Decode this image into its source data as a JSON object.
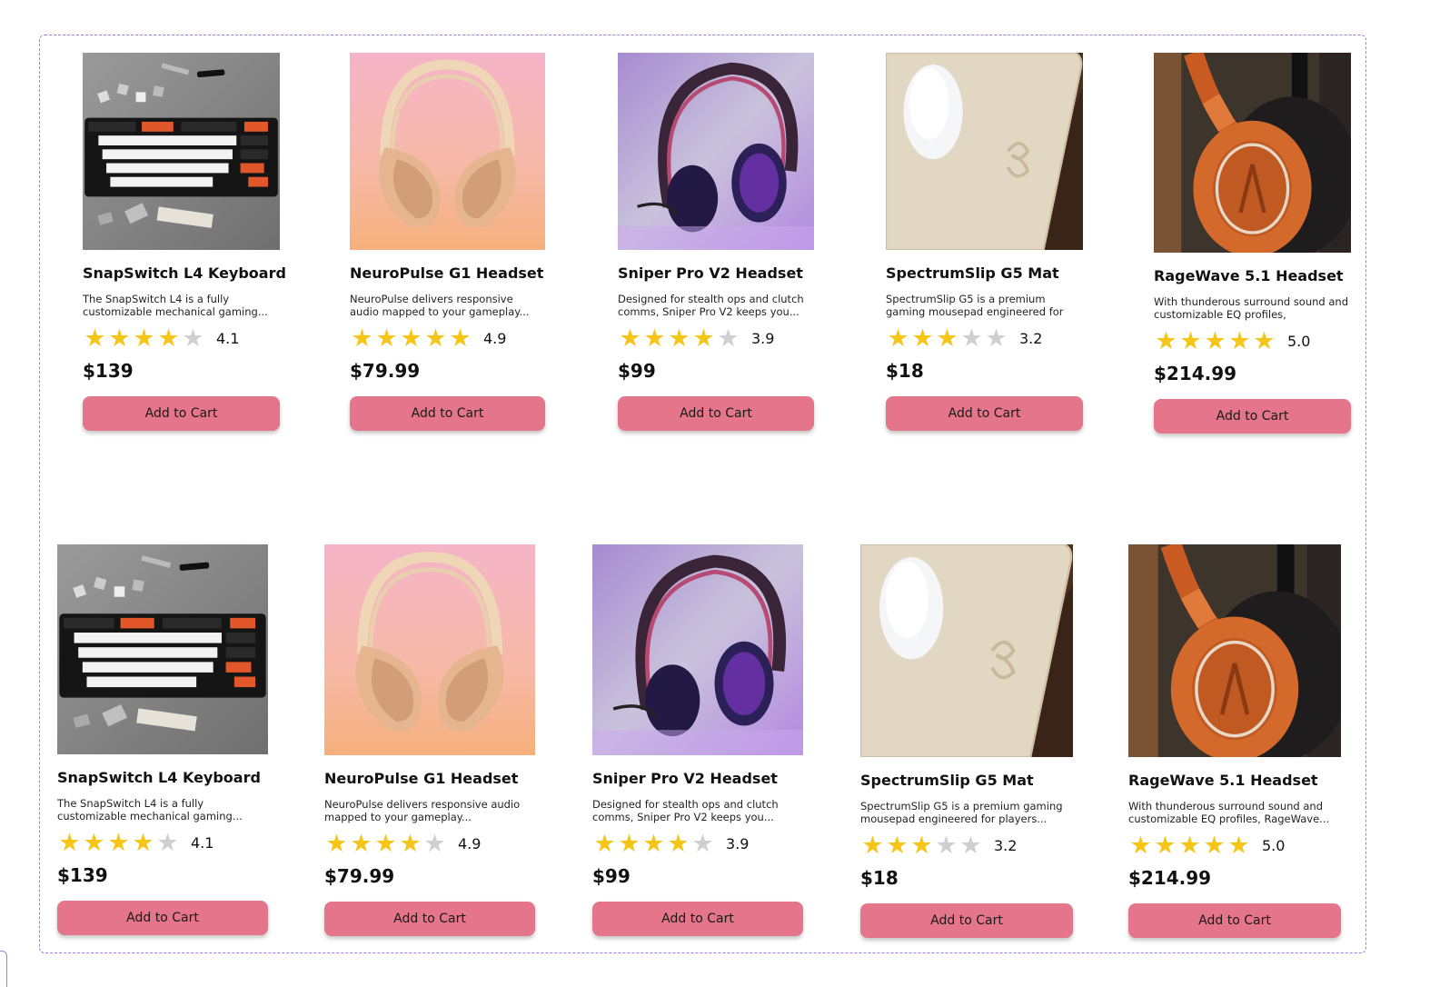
{
  "button_label": "Add to Cart",
  "colors": {
    "accent": "#e5758b",
    "star": "#f5c518",
    "star_empty": "#cfcfcf",
    "frame": "#9b7be8"
  },
  "rows": [
    {
      "products": [
        {
          "image": "keyboard-photo",
          "name": "SnapSwitch L4 Keyboard",
          "description": "The SnapSwitch L4 is a fully customizable mechanical gaming...",
          "rating": 4.1,
          "rating_text": "4.1",
          "stars": 4,
          "price": "$139"
        },
        {
          "image": "headphones-photo",
          "name": "NeuroPulse G1 Headset",
          "description": "NeuroPulse delivers responsive audio mapped to your gameplay...",
          "rating": 4.9,
          "rating_text": "4.9",
          "stars": 5,
          "price": "$79.99"
        },
        {
          "image": "headset-photo",
          "name": "Sniper Pro V2 Headset",
          "description": "Designed for stealth ops and clutch comms, Sniper Pro V2 keeps you...",
          "rating": 3.9,
          "rating_text": "3.9",
          "stars": 4,
          "price": "$99"
        },
        {
          "image": "mousepad-photo",
          "name": "SpectrumSlip G5 Mat",
          "description": "SpectrumSlip G5 is a premium gaming mousepad engineered for players...",
          "rating": 3.2,
          "rating_text": "3.2",
          "stars": 3,
          "price": "$18"
        },
        {
          "image": "orange-headphones-photo",
          "name": "RageWave 5.1 Headset",
          "description": "With thunderous surround sound and customizable EQ profiles, RageWave...",
          "rating": 5.0,
          "rating_text": "5.0",
          "stars": 5,
          "price": "$214.99"
        }
      ]
    },
    {
      "products": [
        {
          "image": "keyboard-photo",
          "name": "SnapSwitch L4 Keyboard",
          "description": "The SnapSwitch L4 is a fully customizable mechanical gaming...",
          "rating": 4.1,
          "rating_text": "4.1",
          "stars": 4,
          "price": "$139"
        },
        {
          "image": "headphones-photo",
          "name": "NeuroPulse G1 Headset",
          "description": "NeuroPulse delivers responsive audio mapped to your gameplay...",
          "rating": 4.9,
          "rating_text": "4.9",
          "stars": 4,
          "price": "$79.99"
        },
        {
          "image": "headset-photo",
          "name": "Sniper Pro V2 Headset",
          "description": "Designed for stealth ops and clutch comms, Sniper Pro V2 keeps you...",
          "rating": 3.9,
          "rating_text": "3.9",
          "stars": 4,
          "price": "$99"
        },
        {
          "image": "mousepad-photo",
          "name": "SpectrumSlip G5 Mat",
          "description": "SpectrumSlip G5 is a premium gaming mousepad engineered for players...",
          "rating": 3.2,
          "rating_text": "3.2",
          "stars": 3,
          "price": "$18"
        },
        {
          "image": "orange-headphones-photo",
          "name": "RageWave 5.1 Headset",
          "description": "With thunderous surround sound and customizable EQ profiles, RageWave...",
          "rating": 5.0,
          "rating_text": "5.0",
          "stars": 5,
          "price": "$214.99"
        }
      ]
    }
  ]
}
